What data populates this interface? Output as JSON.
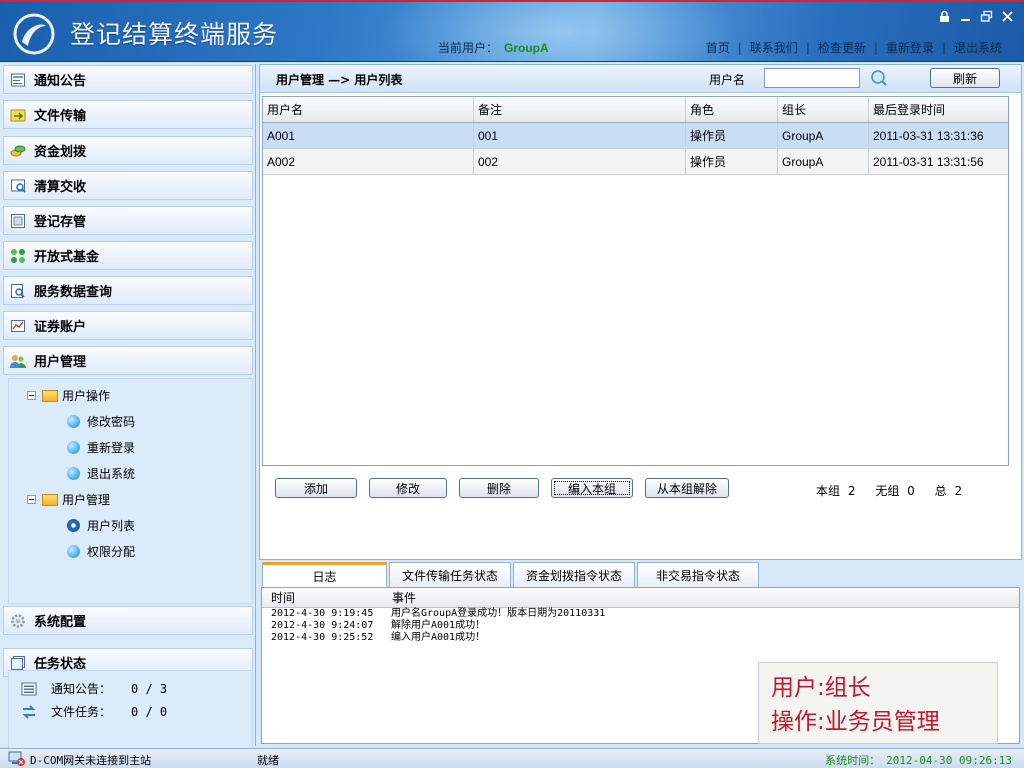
{
  "app": {
    "title": "登记结算终端服务"
  },
  "header": {
    "current_user_label": "当前用户：",
    "current_user": "GroupA",
    "nav": [
      "首页",
      "联系我们",
      "检查更新",
      "重新登录",
      "退出系统"
    ],
    "nav_sep": "|"
  },
  "colors": {
    "brand_blue": "#2d78c6",
    "accent_orange": "#f3a22a",
    "status_green": "#1c8a1c",
    "note_red": "#c0182e"
  },
  "sidebar": {
    "items": [
      {
        "label": "通知公告",
        "icon": "notice-icon"
      },
      {
        "label": "文件传输",
        "icon": "file-transfer-icon"
      },
      {
        "label": "资金划拨",
        "icon": "funds-icon"
      },
      {
        "label": "清算交收",
        "icon": "clearing-icon"
      },
      {
        "label": "登记存管",
        "icon": "registry-icon"
      },
      {
        "label": "开放式基金",
        "icon": "fund-icon"
      },
      {
        "label": "服务数据查询",
        "icon": "query-icon"
      },
      {
        "label": "证券账户",
        "icon": "account-icon"
      },
      {
        "label": "用户管理",
        "icon": "users-icon"
      }
    ],
    "tree": {
      "groups": [
        {
          "label": "用户操作",
          "children": [
            "修改密码",
            "重新登录",
            "退出系统"
          ]
        },
        {
          "label": "用户管理",
          "children": [
            "用户列表",
            "权限分配"
          ]
        }
      ],
      "selected": "用户列表"
    },
    "bottom_items": [
      {
        "label": "系统配置",
        "icon": "gear-icon"
      },
      {
        "label": "任务状态",
        "icon": "task-icon"
      }
    ],
    "tasks": [
      {
        "label": "通知公告：",
        "value": "0 / 3"
      },
      {
        "label": "文件任务：",
        "value": "0 / 0"
      }
    ]
  },
  "main": {
    "breadcrumb": "用户管理 —> 用户列表",
    "search": {
      "label": "用户名",
      "value": "",
      "placeholder": ""
    },
    "refresh_label": "刷新",
    "table": {
      "columns": [
        "用户名",
        "备注",
        "角色",
        "组长",
        "最后登录时间"
      ],
      "rows": [
        [
          "A001",
          "001",
          "操作员",
          "GroupA",
          "2011-03-31 13:31:36"
        ],
        [
          "A002",
          "002",
          "操作员",
          "GroupA",
          "2011-03-31 13:31:56"
        ]
      ],
      "selected_row": 0
    },
    "actions": [
      "添加",
      "修改",
      "删除",
      "编入本组",
      "从本组解除"
    ],
    "counts": {
      "group_label": "本组",
      "group": "2",
      "nogroup_label": "无组",
      "nogroup": "0",
      "total_label": "总",
      "total": "2"
    }
  },
  "log": {
    "tabs": [
      "日志",
      "文件传输任务状态",
      "资金划拨指令状态",
      "非交易指令状态"
    ],
    "active_tab": 0,
    "columns": [
      "时间",
      "事件"
    ],
    "rows": [
      [
        "2012-4-30 9:19:45",
        "用户名GroupA登录成功！版本日期为20110331"
      ],
      [
        "2012-4-30 9:24:07",
        "解除用户A001成功！"
      ],
      [
        "2012-4-30 9:25:52",
        "编入用户A001成功！"
      ]
    ]
  },
  "note": {
    "line1": "用户:组长",
    "line2": "操作:业务员管理"
  },
  "status": {
    "connection": "D-COM网关未连接到主站",
    "ready": "就绪",
    "time_label": "系统时间：",
    "time": "2012-04-30 09:26:13"
  }
}
